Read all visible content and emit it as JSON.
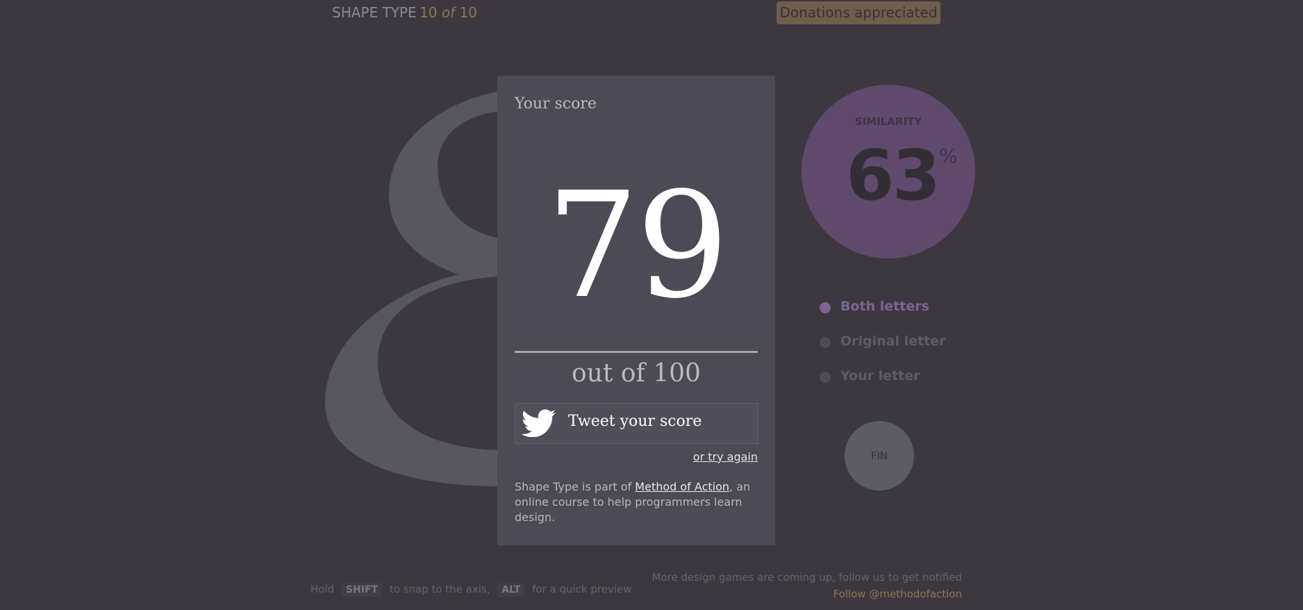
{
  "header": {
    "title": "SHAPE TYPE",
    "progress_current": "10",
    "progress_of": "of",
    "progress_total": "10",
    "donate_label": "Donations appreciated"
  },
  "background_glyph": "8",
  "score_panel": {
    "heading": "Your score",
    "score": "79",
    "out_of": "out of 100",
    "tweet_label": "Tweet your score",
    "try_again": "or try again",
    "about_prefix": "Shape Type is part of ",
    "about_link": "Method of Action",
    "about_suffix": ", an online course to help programmers learn design."
  },
  "similarity": {
    "label": "SIMILARITY",
    "value": "63",
    "unit": "%"
  },
  "view_options": [
    {
      "label": "Both letters",
      "selected": true
    },
    {
      "label": "Original letter",
      "selected": false
    },
    {
      "label": "Your letter",
      "selected": false
    }
  ],
  "fin_label": "FIN",
  "footer": {
    "hint_hold": "Hold",
    "key_shift": "SHIFT",
    "hint_snap": "to snap to the axis,",
    "key_alt": "ALT",
    "hint_preview": "for a quick preview",
    "more_games": "More design games are coming up, follow us to get notified",
    "follow": "Follow @methodofaction"
  },
  "colors": {
    "background": "#3d383f",
    "panel": "#4b4a55",
    "accent_gold": "#8a7658",
    "accent_purple": "#7d6490",
    "similarity_circle": "#5f4a6c"
  }
}
